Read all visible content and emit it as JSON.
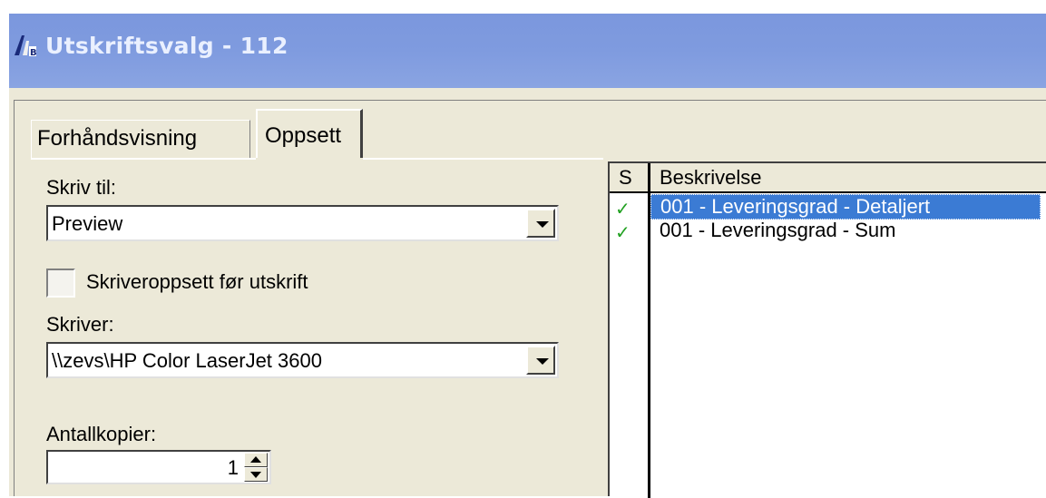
{
  "window": {
    "title": "Utskriftsvalg - 112"
  },
  "tabs": [
    {
      "label": "Forhåndsvisning",
      "active": false
    },
    {
      "label": "Oppsett",
      "active": true
    }
  ],
  "form": {
    "write_to": {
      "label": "Skriv til:",
      "value": "Preview"
    },
    "printer_setup_checkbox": {
      "label": "Skriveroppsett før utskrift",
      "checked": false
    },
    "printer": {
      "label": "Skriver:",
      "value": "\\\\zevs\\HP Color LaserJet 3600"
    },
    "copies": {
      "label": "Antallkopier:",
      "value": "1"
    }
  },
  "report_list": {
    "columns": [
      "S",
      "Beskrivelse"
    ],
    "rows": [
      {
        "selected_mark": "✓",
        "description": "001 - Leveringsgrad - Detaljert",
        "highlighted": true
      },
      {
        "selected_mark": "✓",
        "description": "001 - Leveringsgrad - Sum",
        "highlighted": false
      }
    ]
  },
  "colors": {
    "titlebar": "#7b97dd",
    "dialog_bg": "#ece9d8",
    "selection": "#3b7bd4",
    "check": "#21a121"
  }
}
